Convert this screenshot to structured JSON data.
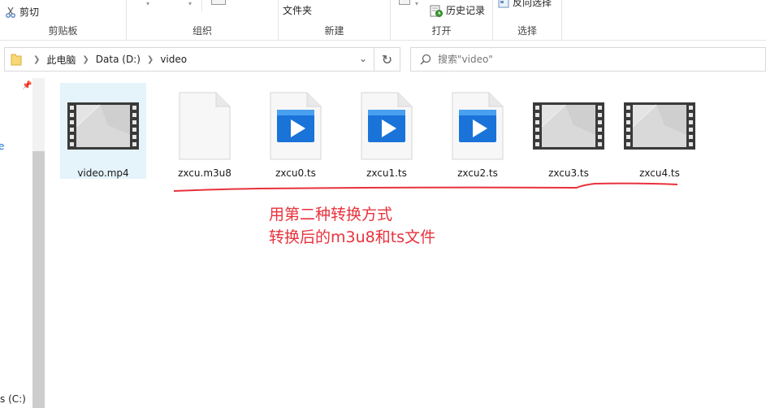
{
  "ribbon": {
    "clipboard": {
      "cut_label": "剪切",
      "group_label": "剪贴板"
    },
    "organize": {
      "group_label": "组织"
    },
    "new": {
      "folder_label": "文件夹",
      "group_label": "新建"
    },
    "open": {
      "history_label": "历史记录",
      "group_label": "打开"
    },
    "select": {
      "invert_label": "反向选择",
      "group_label": "选择"
    }
  },
  "address": {
    "breadcrumbs": [
      "此电脑",
      "Data (D:)",
      "video"
    ]
  },
  "search": {
    "placeholder": "搜索\"video\""
  },
  "navpane": {
    "drive_label": "s (C:)",
    "partial_label": "e"
  },
  "files": [
    {
      "name": "video.mp4",
      "icon": "video-thumbnail-icon",
      "selected": true
    },
    {
      "name": "zxcu.m3u8",
      "icon": "blank-file-icon",
      "selected": false
    },
    {
      "name": "zxcu0.ts",
      "icon": "media-player-icon",
      "selected": false
    },
    {
      "name": "zxcu1.ts",
      "icon": "media-player-icon",
      "selected": false
    },
    {
      "name": "zxcu2.ts",
      "icon": "media-player-icon",
      "selected": false
    },
    {
      "name": "zxcu3.ts",
      "icon": "video-thumbnail-icon",
      "selected": false
    },
    {
      "name": "zxcu4.ts",
      "icon": "video-thumbnail-icon",
      "selected": false
    }
  ],
  "annotation": {
    "line1": "用第二种转换方式",
    "line2": "转换后的m3u8和ts文件",
    "color": "#e8323c"
  },
  "colors": {
    "selection": "#e5f3fb",
    "accent": "#1a73d9"
  }
}
